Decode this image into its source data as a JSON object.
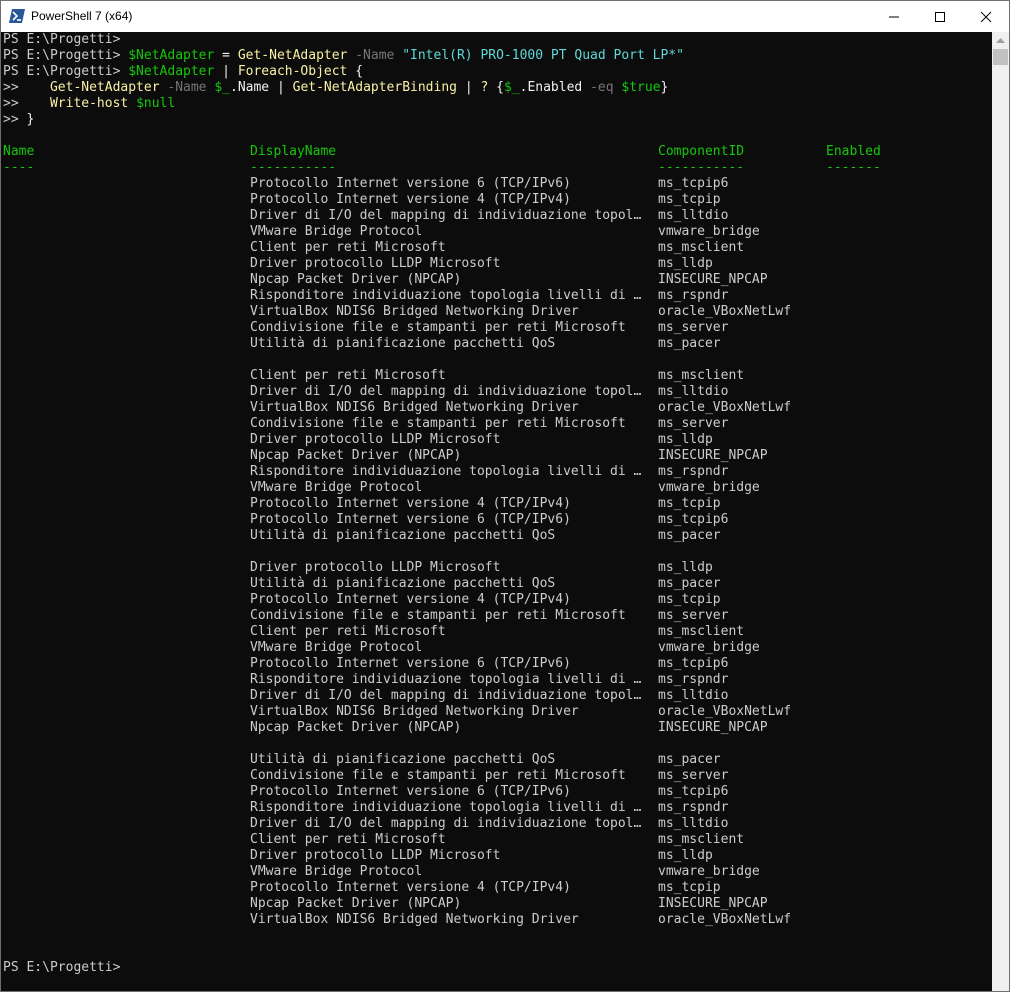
{
  "window": {
    "title": "PowerShell 7 (x64)"
  },
  "prompt": {
    "ps": "PS",
    "path": "E:\\Progetti>",
    "cont": ">>"
  },
  "commands": {
    "line1": {
      "var": "$NetAdapter",
      "eq": "=",
      "cmdlet": "Get-NetAdapter",
      "param": "-Name",
      "value": "\"Intel(R) PRO-1000 PT Quad Port LP*\""
    },
    "line2": {
      "var": "$NetAdapter",
      "pipe": "|",
      "cmdlet": "Foreach-Object",
      "brace": "{"
    },
    "line3": {
      "cmdlet": "Get-NetAdapter",
      "param": "-Name",
      "var": "$_",
      "prop": ".Name",
      "pipe": "|",
      "cmdlet2": "Get-NetAdapterBinding",
      "pipe2": "|",
      "q": "?",
      "open": "{",
      "var2": "$_",
      "prop2": ".Enabled",
      "op": "-eq",
      "val": "$true",
      "close": "}"
    },
    "line4": {
      "cmdlet": "Write-host",
      "var": "$null"
    },
    "line5": {
      "brace": "}"
    }
  },
  "table": {
    "headers": {
      "name": "Name",
      "display": "DisplayName",
      "component": "ComponentID",
      "enabled": "Enabled"
    },
    "underlines": {
      "name": "----",
      "display": "-----------",
      "component": "-----------",
      "enabled": "-------"
    },
    "groups": [
      [
        {
          "display": "Protocollo Internet versione 6 (TCP/IPv6)",
          "component": "ms_tcpip6"
        },
        {
          "display": "Protocollo Internet versione 4 (TCP/IPv4)",
          "component": "ms_tcpip"
        },
        {
          "display": "Driver di I/O del mapping di individuazione topol…",
          "component": "ms_lltdio"
        },
        {
          "display": "VMware Bridge Protocol",
          "component": "vmware_bridge"
        },
        {
          "display": "Client per reti Microsoft",
          "component": "ms_msclient"
        },
        {
          "display": "Driver protocollo LLDP Microsoft",
          "component": "ms_lldp"
        },
        {
          "display": "Npcap Packet Driver (NPCAP)",
          "component": "INSECURE_NPCAP"
        },
        {
          "display": "Risponditore individuazione topologia livelli di …",
          "component": "ms_rspndr"
        },
        {
          "display": "VirtualBox NDIS6 Bridged Networking Driver",
          "component": "oracle_VBoxNetLwf"
        },
        {
          "display": "Condivisione file e stampanti per reti Microsoft",
          "component": "ms_server"
        },
        {
          "display": "Utilità di pianificazione pacchetti QoS",
          "component": "ms_pacer"
        }
      ],
      [
        {
          "display": "Client per reti Microsoft",
          "component": "ms_msclient"
        },
        {
          "display": "Driver di I/O del mapping di individuazione topol…",
          "component": "ms_lltdio"
        },
        {
          "display": "VirtualBox NDIS6 Bridged Networking Driver",
          "component": "oracle_VBoxNetLwf"
        },
        {
          "display": "Condivisione file e stampanti per reti Microsoft",
          "component": "ms_server"
        },
        {
          "display": "Driver protocollo LLDP Microsoft",
          "component": "ms_lldp"
        },
        {
          "display": "Npcap Packet Driver (NPCAP)",
          "component": "INSECURE_NPCAP"
        },
        {
          "display": "Risponditore individuazione topologia livelli di …",
          "component": "ms_rspndr"
        },
        {
          "display": "VMware Bridge Protocol",
          "component": "vmware_bridge"
        },
        {
          "display": "Protocollo Internet versione 4 (TCP/IPv4)",
          "component": "ms_tcpip"
        },
        {
          "display": "Protocollo Internet versione 6 (TCP/IPv6)",
          "component": "ms_tcpip6"
        },
        {
          "display": "Utilità di pianificazione pacchetti QoS",
          "component": "ms_pacer"
        }
      ],
      [
        {
          "display": "Driver protocollo LLDP Microsoft",
          "component": "ms_lldp"
        },
        {
          "display": "Utilità di pianificazione pacchetti QoS",
          "component": "ms_pacer"
        },
        {
          "display": "Protocollo Internet versione 4 (TCP/IPv4)",
          "component": "ms_tcpip"
        },
        {
          "display": "Condivisione file e stampanti per reti Microsoft",
          "component": "ms_server"
        },
        {
          "display": "Client per reti Microsoft",
          "component": "ms_msclient"
        },
        {
          "display": "VMware Bridge Protocol",
          "component": "vmware_bridge"
        },
        {
          "display": "Protocollo Internet versione 6 (TCP/IPv6)",
          "component": "ms_tcpip6"
        },
        {
          "display": "Risponditore individuazione topologia livelli di …",
          "component": "ms_rspndr"
        },
        {
          "display": "Driver di I/O del mapping di individuazione topol…",
          "component": "ms_lltdio"
        },
        {
          "display": "VirtualBox NDIS6 Bridged Networking Driver",
          "component": "oracle_VBoxNetLwf"
        },
        {
          "display": "Npcap Packet Driver (NPCAP)",
          "component": "INSECURE_NPCAP"
        }
      ],
      [
        {
          "display": "Utilità di pianificazione pacchetti QoS",
          "component": "ms_pacer"
        },
        {
          "display": "Condivisione file e stampanti per reti Microsoft",
          "component": "ms_server"
        },
        {
          "display": "Protocollo Internet versione 6 (TCP/IPv6)",
          "component": "ms_tcpip6"
        },
        {
          "display": "Risponditore individuazione topologia livelli di …",
          "component": "ms_rspndr"
        },
        {
          "display": "Driver di I/O del mapping di individuazione topol…",
          "component": "ms_lltdio"
        },
        {
          "display": "Client per reti Microsoft",
          "component": "ms_msclient"
        },
        {
          "display": "Driver protocollo LLDP Microsoft",
          "component": "ms_lldp"
        },
        {
          "display": "VMware Bridge Protocol",
          "component": "vmware_bridge"
        },
        {
          "display": "Protocollo Internet versione 4 (TCP/IPv4)",
          "component": "ms_tcpip"
        },
        {
          "display": "Npcap Packet Driver (NPCAP)",
          "component": "INSECURE_NPCAP"
        },
        {
          "display": "VirtualBox NDIS6 Bridged Networking Driver",
          "component": "oracle_VBoxNetLwf"
        }
      ]
    ]
  },
  "colors": {
    "background": "#0c0c0c",
    "text": "#cccccc",
    "header": "#16c60c",
    "variable": "#16c60c",
    "cmdlet": "#f9f1a5",
    "parameter": "#767676",
    "string": "#61d6d6"
  },
  "icons": {
    "app": "powershell-icon",
    "minimize": "minimize-icon",
    "maximize": "maximize-icon",
    "close": "close-icon",
    "scroll_up": "chevron-up-icon"
  }
}
